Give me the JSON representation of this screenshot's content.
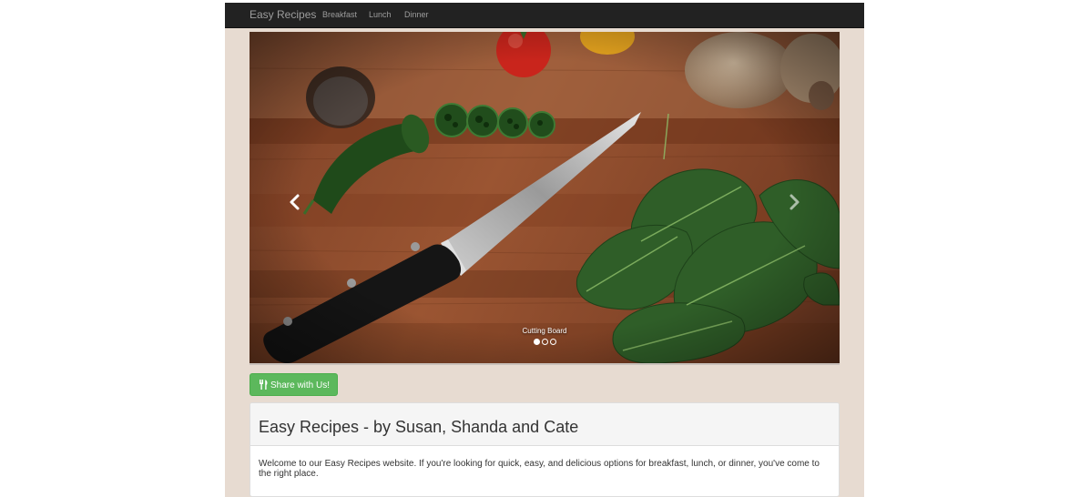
{
  "navbar": {
    "brand": "Easy Recipes",
    "links": [
      "Breakfast",
      "Lunch",
      "Dinner"
    ]
  },
  "carousel": {
    "caption": "Cutting Board",
    "slide_count": 3,
    "active_index": 0,
    "prev_icon": "chevron-left-icon",
    "next_icon": "chevron-right-icon"
  },
  "share_button": {
    "label": "Share with Us!",
    "icon": "cutlery-icon"
  },
  "panel": {
    "title": "Easy Recipes - by Susan, Shanda and Cate",
    "body": "Welcome to our Easy Recipes website. If you're looking for quick, easy, and delicious options for breakfast, lunch, or dinner, you've come to the right place."
  },
  "colors": {
    "navbar_bg": "#222222",
    "page_bg": "#e7dbd1",
    "button_green": "#5cb85c"
  }
}
